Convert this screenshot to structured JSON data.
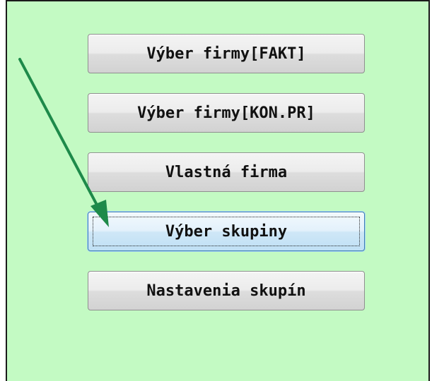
{
  "buttons": [
    {
      "label": "Výber firmy[FAKT]"
    },
    {
      "label": "Výber firmy[KON.PR]"
    },
    {
      "label": "Vlastná firma"
    },
    {
      "label": "Výber skupiny",
      "focused": true
    },
    {
      "label": "Nastavenia skupín"
    }
  ],
  "colors": {
    "background": "#c3fac3",
    "arrow": "#1e8a4a"
  },
  "icons": {
    "annotation": "arrow-icon"
  }
}
